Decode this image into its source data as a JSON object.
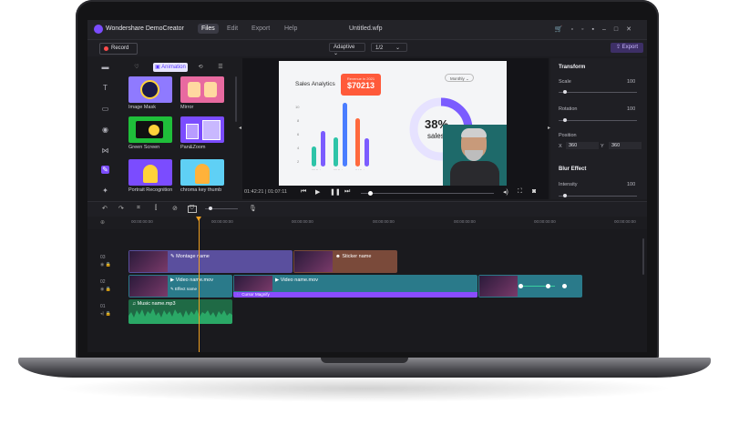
{
  "app": {
    "name": "Wondershare DemoCreator",
    "menu": [
      "Files",
      "Edit",
      "Export",
      "Help"
    ],
    "active_menu": "Files",
    "document_title": "Untitled.wfp",
    "record_label": "Record",
    "export_label": "Export",
    "zoom_mode": "Adaptive",
    "ratio": "1/2"
  },
  "media_panel": {
    "items": [
      {
        "label": "Image Mask"
      },
      {
        "label": "Mirror"
      },
      {
        "label": "Green Screen"
      },
      {
        "label": "Pan&Zoom"
      },
      {
        "label": "Portrait Recognition"
      },
      {
        "label": "chroma key thumb"
      }
    ]
  },
  "preview": {
    "slide_title": "Sales Analytics",
    "revenue_caption": "Revenue in 2021",
    "revenue_value": "$70213",
    "dropdown_label": "Monthly",
    "donut_percent": "38%",
    "donut_label": "sales",
    "time_current": "01:42:21",
    "time_total": "01:07:11",
    "bar_labels": [
      "22 Feb",
      "23 Feb",
      "24 Feb"
    ],
    "y_ticks": [
      "10",
      "8",
      "6",
      "4",
      "2"
    ],
    "colors": {
      "teal": "#2ec4a8",
      "blue": "#4a7dff",
      "orange": "#ff6a3d",
      "purple": "#7b5cff",
      "revenue_badge": "#ff5a3a"
    }
  },
  "properties": {
    "transform_heading": "Transform",
    "scale_label": "Scale",
    "scale_value": "100",
    "rotation_label": "Rotation",
    "rotation_value": "100",
    "position_label": "Position",
    "pos_x_label": "X",
    "pos_x": "360",
    "pos_y_label": "Y",
    "pos_y": "360",
    "blur_heading": "Blur Effect",
    "intensity_label": "Intensity",
    "intensity_value": "100"
  },
  "timeline": {
    "ruler_ticks": [
      "00:00:00:00",
      "00:00:00:00",
      "00:00:00:00",
      "00:00:00:00",
      "00:00:00:00",
      "00:00:00:00",
      "00:00:00:00"
    ],
    "track_numbers": [
      "03",
      "02",
      "01"
    ],
    "clips": {
      "montage": "Montage name",
      "sticker": "Sticker name",
      "video1": "Video name.mov",
      "effect": "Effect name",
      "video2": "Video name.mov",
      "cursor": "Cursor Magnify",
      "music": "Music name.mp3"
    },
    "colors": {
      "purple_clip": "#5a4f9e",
      "brown_clip": "#7a4a3a",
      "teal_clip": "#2a7a8a",
      "music_clip": "#2a8a55",
      "cursor_bar": "#8a4cff",
      "playhead": "#f0a020"
    }
  }
}
